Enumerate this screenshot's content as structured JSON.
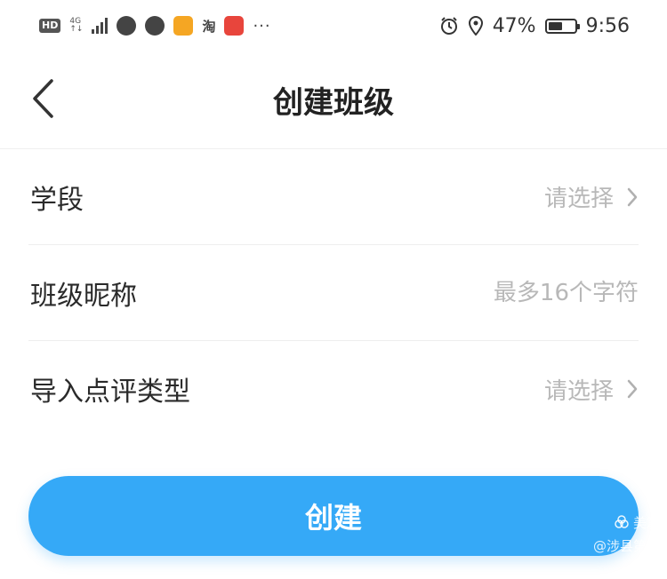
{
  "status_bar": {
    "hd": "HD",
    "network": "4G",
    "network_sub": "↑↓",
    "tao": "淘",
    "dots": "···",
    "battery_percent": "47%",
    "battery_level": 0.47,
    "time": "9:56"
  },
  "nav": {
    "title": "创建班级"
  },
  "form": {
    "rows": [
      {
        "label": "学段",
        "value": "请选择"
      },
      {
        "label": "班级昵称",
        "placeholder": "最多16个字符"
      },
      {
        "label": "导入点评类型",
        "value": "请选择"
      }
    ]
  },
  "create_button": {
    "label": "创建"
  },
  "watermark": {
    "brand": "美篇",
    "author": "@涉县第三"
  },
  "colors": {
    "accent": "#35a9f7",
    "placeholder": "#b8b8b8"
  }
}
